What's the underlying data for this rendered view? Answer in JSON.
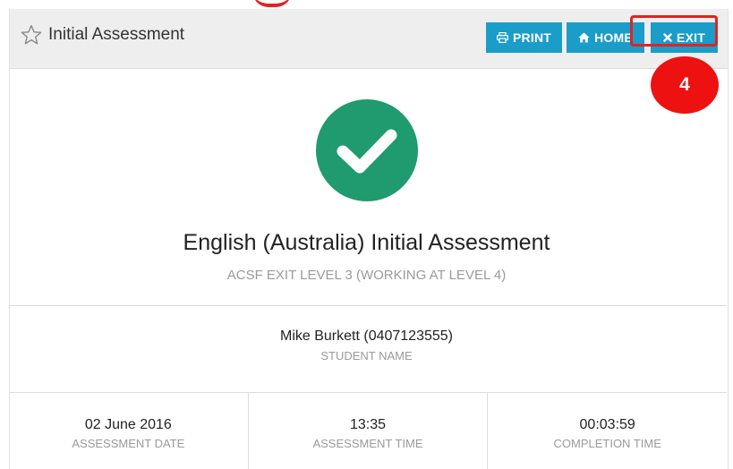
{
  "header": {
    "title": "Initial Assessment",
    "star_icon": "star-outline-icon"
  },
  "toolbar": {
    "print_label": "PRINT",
    "home_label": "HOME",
    "exit_label": "EXIT",
    "button_color": "#1a9dc9"
  },
  "annotation": {
    "step_number": "4",
    "highlight_color": "#e32222"
  },
  "result": {
    "status_icon": "check-circle-icon",
    "status_color": "#1f9b6f",
    "title": "English (Australia) Initial Assessment",
    "level": "ACSF EXIT LEVEL 3 (WORKING AT LEVEL 4)"
  },
  "student": {
    "name": "Mike Burkett (0407123555)",
    "caption": "STUDENT NAME"
  },
  "stats": [
    {
      "value": "02 June 2016",
      "caption": "ASSESSMENT DATE"
    },
    {
      "value": "13:35",
      "caption": "ASSESSMENT TIME"
    },
    {
      "value": "00:03:59",
      "caption": "COMPLETION TIME"
    }
  ]
}
